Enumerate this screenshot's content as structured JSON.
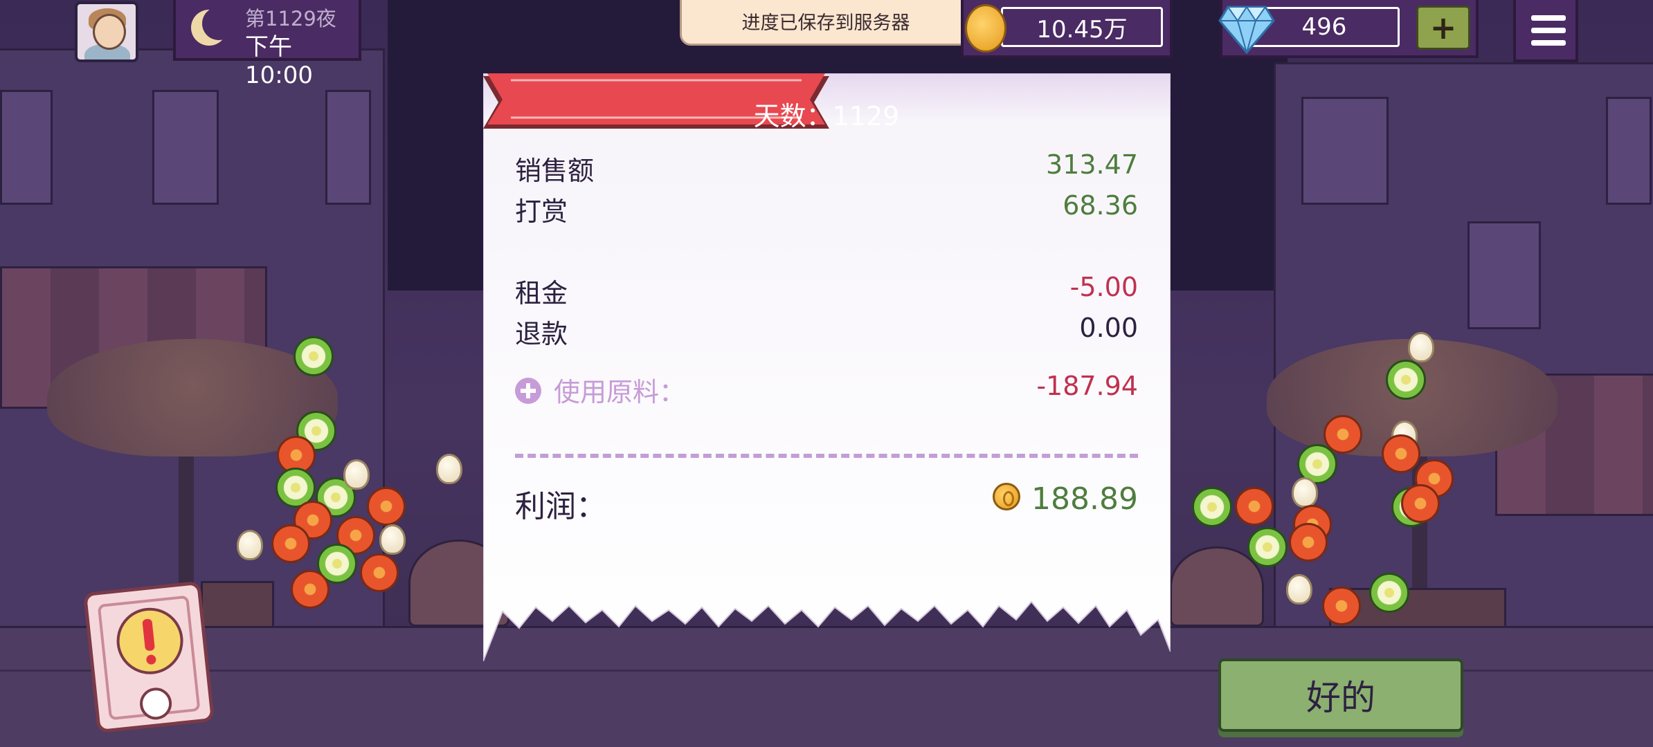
{
  "hud": {
    "day_label": "第1129夜",
    "time_label": "下午10:00",
    "coins": "10.45万",
    "gems": "496",
    "plus_label": "+"
  },
  "toast": {
    "text": "进度已保存到服务器"
  },
  "receipt": {
    "title": "天数：1129",
    "sales_label": "销售额",
    "sales_value": "313.47",
    "tips_label": "打赏",
    "tips_value": "68.36",
    "rent_label": "租金",
    "rent_value": "-5.00",
    "refund_label": "退款",
    "refund_value": "0.00",
    "ingredients_label": "使用原料：",
    "ingredients_value": "-187.94",
    "profit_label": "利润：",
    "profit_value": "188.89"
  },
  "buttons": {
    "ok_label": "好的"
  },
  "colors": {
    "positive": "#4e7d3e",
    "negative": "#c0314f",
    "ribbon": "#e8484f",
    "panel": "#4b2b63",
    "ok_button": "#8bb070"
  },
  "icons": {
    "avatar": "player-avatar",
    "moon": "moon-icon",
    "coin": "coin-icon",
    "gem": "diamond-icon",
    "menu": "hamburger-menu-icon",
    "expand": "plus-circle-icon",
    "alert": "exclamation-alert-icon"
  }
}
